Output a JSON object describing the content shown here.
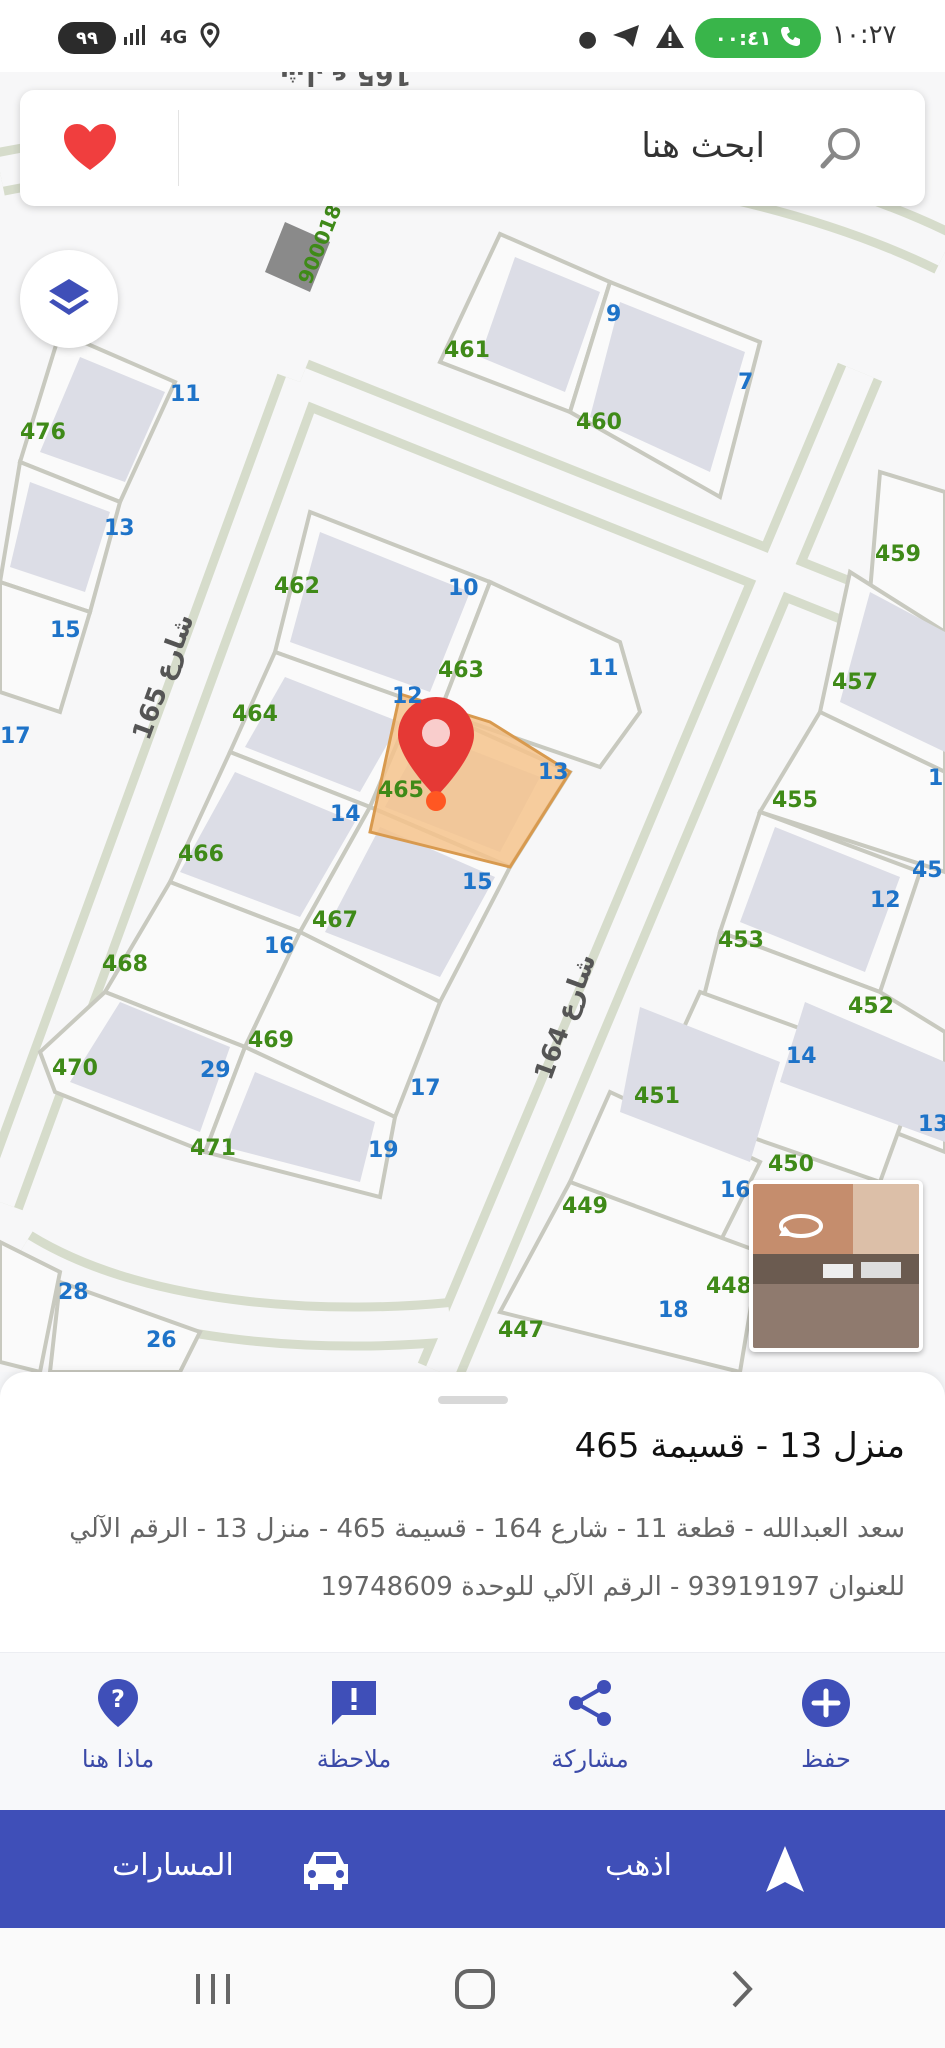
{
  "status_bar": {
    "time": "١٠:٢٧",
    "call_timer": "٠٠:٤١",
    "battery": "٩٩",
    "network": "4G"
  },
  "search": {
    "placeholder": "ابحث هنا",
    "favorite_icon": "heart-icon",
    "search_icon": "search-icon"
  },
  "map": {
    "streets": [
      "شارع 165",
      "شارع 164",
      "شارع 165"
    ],
    "parcel_numbers": [
      "900018",
      "461",
      "460",
      "476",
      "459",
      "462",
      "463",
      "464",
      "465",
      "466",
      "467",
      "468",
      "469",
      "470",
      "471",
      "457",
      "455",
      "453",
      "452",
      "451",
      "450",
      "449",
      "448",
      "447"
    ],
    "house_numbers": [
      "9",
      "7",
      "11",
      "13",
      "15",
      "17",
      "10",
      "11",
      "12",
      "13",
      "14",
      "15",
      "16",
      "17",
      "19",
      "29",
      "28",
      "26",
      "12",
      "14",
      "16",
      "18",
      "13",
      "1",
      "45"
    ],
    "selected": {
      "parcel": "465",
      "house": "13"
    },
    "layers_icon": "layers-icon",
    "street_view_icon": "rotate-360-icon"
  },
  "sheet": {
    "title": "منزل 13 - قسيمة 465",
    "description": "سعد العبدالله - قطعة 11 - شارع 164 - قسيمة 465 - منزل 13 - الرقم الآلي للعنوان 93919197 - الرقم الآلي للوحدة 19748609"
  },
  "actions": [
    {
      "label": "حفظ",
      "icon": "add-circle-icon"
    },
    {
      "label": "مشاركة",
      "icon": "share-icon"
    },
    {
      "label": "ملاحظة",
      "icon": "feedback-icon"
    },
    {
      "label": "ماذا هنا",
      "icon": "question-icon"
    }
  ],
  "navigation": {
    "go_label": "اذهب",
    "routes_label": "المسارات"
  },
  "colors": {
    "accent": "#3f4fb8",
    "house_number": "#1e73c8",
    "parcel_number": "#3f8a18",
    "selected_fill": "#f4c38c",
    "pin": "#e53935"
  }
}
